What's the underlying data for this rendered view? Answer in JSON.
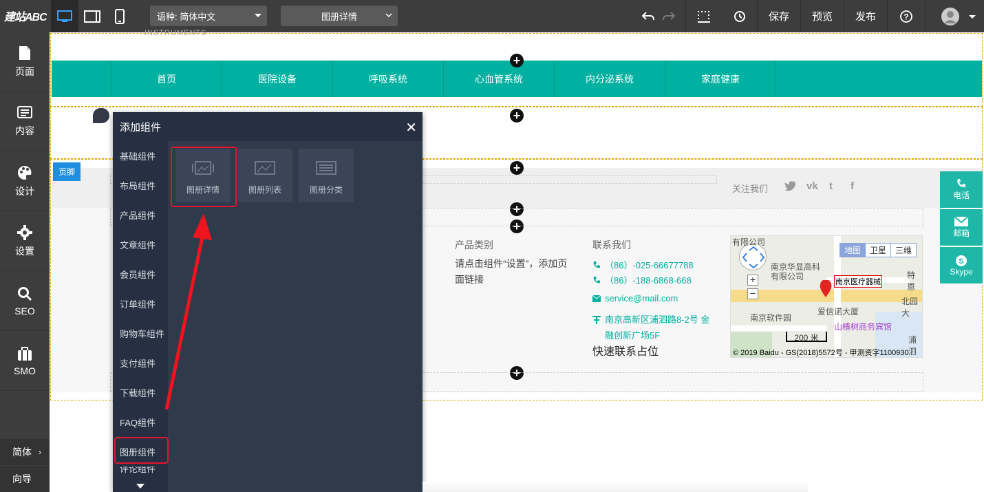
{
  "topbar": {
    "logo": "建站ABC",
    "language_select": "语种: 简体中文",
    "page_select": "图册详情",
    "save": "保存",
    "preview": "预览",
    "publish": "发布"
  },
  "sidebar": {
    "items": [
      {
        "label": "页面",
        "icon": "file-icon"
      },
      {
        "label": "内容",
        "icon": "list-icon"
      },
      {
        "label": "设计",
        "icon": "palette-icon"
      },
      {
        "label": "设置",
        "icon": "gear-icon"
      },
      {
        "label": "SEO",
        "icon": "search-icon"
      },
      {
        "label": "SMO",
        "icon": "briefcase-icon"
      }
    ],
    "lang": "简体",
    "guide": "向导"
  },
  "nav": {
    "items": [
      "首页",
      "医院设备",
      "呼吸系统",
      "心血管系统",
      "内分泌系统",
      "家庭健康"
    ]
  },
  "header_fragment": "INSTRUMENTS",
  "footer": {
    "badge": "页脚",
    "follow_label": "关注我们",
    "product_title": "产品类别",
    "product_text": "请点击组件“设置”，添加页面链接",
    "contact_title": "联系我们",
    "phone1": "（86）-025-66677788",
    "phone2": "（86）-188-6868-668",
    "email": "service@mail.com",
    "address": "南京高新区浦泗路8-2号 金融创新广场5F",
    "quick_contact": "快速联系占位"
  },
  "map": {
    "tabs": [
      "地图",
      "卫星",
      "三维"
    ],
    "labels": [
      "有限公司",
      "南京华显高科",
      "有限公司",
      "南京医疗器械",
      "特恩",
      "北园大",
      "南京软件园",
      "爱信诺大厦",
      "山楂树商务宾馆",
      "浦泗立"
    ],
    "scale": "200 米",
    "copyright": "© 2019 Baidu - GS(2018)5572号 - 甲测资字1100930"
  },
  "right_rail": [
    {
      "label": "电话",
      "icon": "phone-icon"
    },
    {
      "label": "邮箱",
      "icon": "mail-icon"
    },
    {
      "label": "Skype",
      "icon": "skype-icon"
    }
  ],
  "panel": {
    "title": "添加组件",
    "nav": [
      "基础组件",
      "布局组件",
      "产品组件",
      "文章组件",
      "会员组件",
      "订单组件",
      "购物车组件",
      "支付组件",
      "下载组件",
      "FAQ组件",
      "图册组件",
      "评论组件"
    ],
    "tiles": [
      "图册详情",
      "图册列表",
      "图册分类"
    ]
  },
  "colors": {
    "nav_bg": "#00b0a0",
    "topbar_bg": "#3d3d3d",
    "panel_bg": "#2f3a4b",
    "highlight": "#e5132e",
    "accent_blue": "#1e8fe0"
  }
}
